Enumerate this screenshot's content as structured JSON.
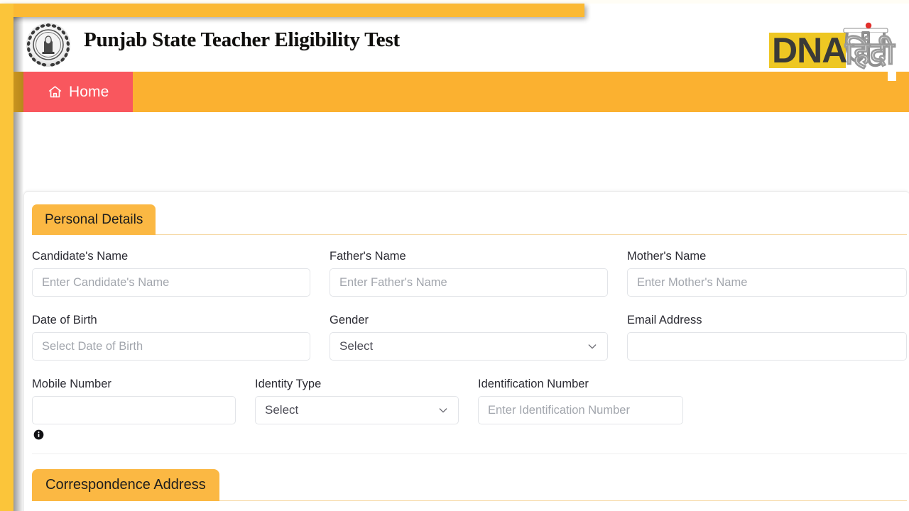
{
  "site": {
    "title": "Punjab State Teacher Eligibility Test",
    "crest_icon": "government-emblem-icon",
    "watermark_primary": "DNA",
    "watermark_secondary": "हिंदी"
  },
  "nav": {
    "home_label": "Home",
    "home_icon": "home-icon"
  },
  "colors": {
    "yellow_band": "#FBB933",
    "left_rail": "#FBC53A",
    "navbar": "#FBB130",
    "home_tab": "#F9575E",
    "section_tab": "#FBB843",
    "tab_underline": "#F6D9A6",
    "input_border": "#E2E4E8",
    "placeholder": "#A2A6AD",
    "label_text": "#2B2B33"
  },
  "form": {
    "sections": [
      {
        "id": "personal-details",
        "label": "Personal Details",
        "active": true
      },
      {
        "id": "correspondence-address",
        "label": "Correspondence Address",
        "active": false
      }
    ],
    "fields": [
      {
        "id": "candidates-name",
        "label": "Candidate's Name",
        "type": "text",
        "value": "",
        "placeholder": "Enter Candidate's Name"
      },
      {
        "id": "fathers-name",
        "label": "Father's Name",
        "type": "text",
        "value": "",
        "placeholder": "Enter Father's Name"
      },
      {
        "id": "mothers-name",
        "label": "Mother's Name",
        "type": "text",
        "value": "",
        "placeholder": "Enter Mother's Name"
      },
      {
        "id": "date-of-birth",
        "label": "Date of Birth",
        "type": "text",
        "value": "",
        "placeholder": "Select Date of Birth"
      },
      {
        "id": "gender",
        "label": "Gender",
        "type": "select",
        "value": "Select",
        "placeholder": ""
      },
      {
        "id": "email-address",
        "label": "Email Address",
        "type": "text",
        "value": "",
        "placeholder": ""
      },
      {
        "id": "mobile-number",
        "label": "Mobile Number",
        "type": "text",
        "value": "",
        "placeholder": "",
        "info_icon": "info-icon"
      },
      {
        "id": "identity-type",
        "label": "Identity Type",
        "type": "select",
        "value": "Select",
        "placeholder": ""
      },
      {
        "id": "identification-number",
        "label": "Identification Number",
        "type": "text",
        "value": "",
        "placeholder": "Enter Identification Number"
      }
    ]
  }
}
